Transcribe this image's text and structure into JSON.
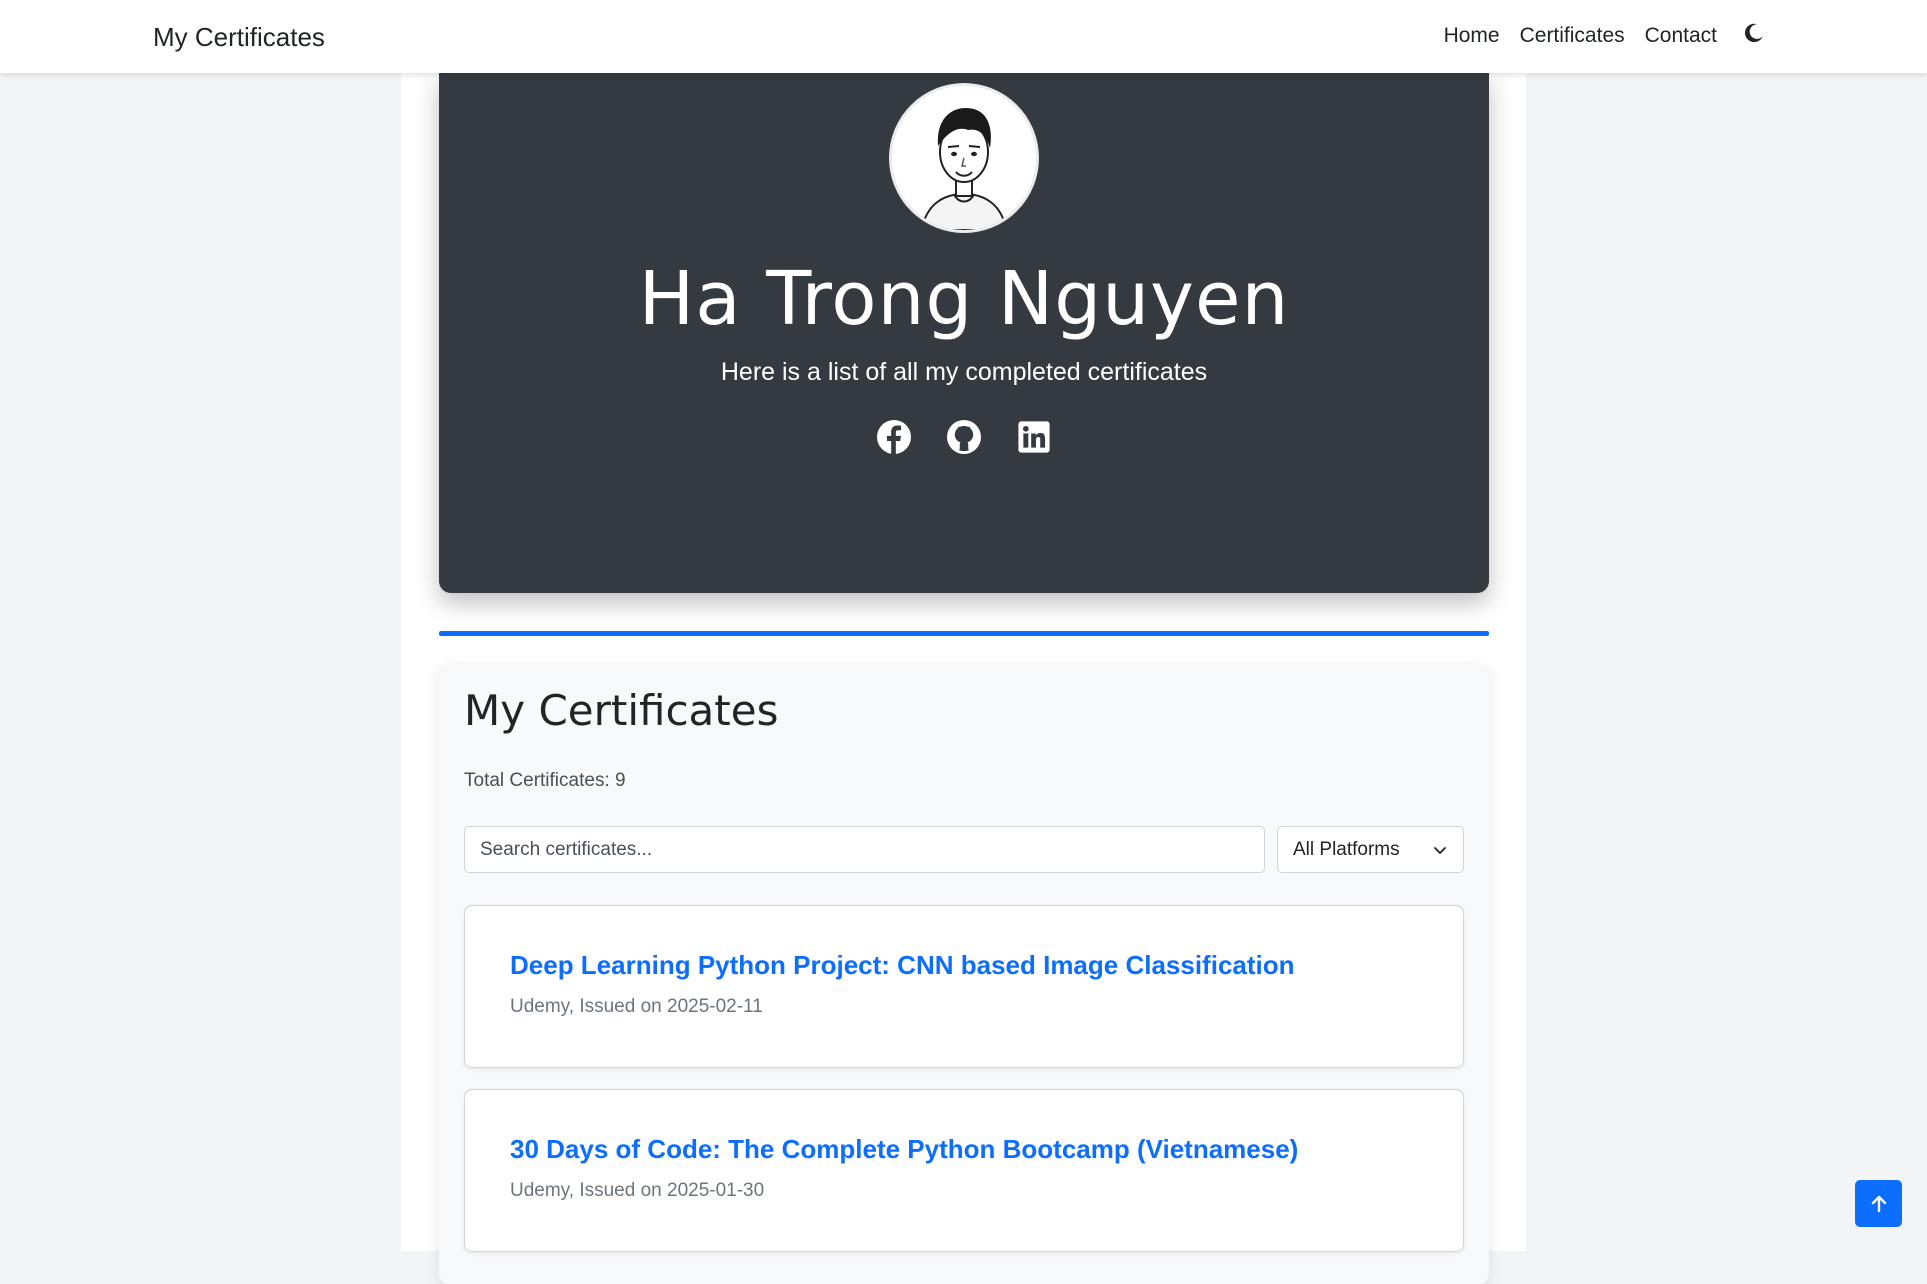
{
  "navbar": {
    "brand": "My Certificates",
    "links": [
      "Home",
      "Certificates",
      "Contact"
    ],
    "theme_toggle_icon": "moon-icon"
  },
  "hero": {
    "name": "Ha Trong Nguyen",
    "subtitle": "Here is a list of all my completed certificates",
    "socials": [
      "facebook-icon",
      "github-icon",
      "linkedin-icon"
    ]
  },
  "certificates": {
    "title": "My Certificates",
    "total_label": "Total Certificates: 9",
    "search_placeholder": "Search certificates...",
    "platform_filter": "All Platforms",
    "items": [
      {
        "title": "Deep Learning Python Project: CNN based Image Classification",
        "meta": "Udemy, Issued on 2025-02-11"
      },
      {
        "title": "30 Days of Code: The Complete Python Bootcamp (Vietnamese)",
        "meta": "Udemy, Issued on 2025-01-30"
      }
    ]
  },
  "colors": {
    "accent": "#0d6efd",
    "hero_bg": "#343a40",
    "page_bg": "#f3f4f6"
  },
  "scroll_top_icon": "arrow-up-icon"
}
